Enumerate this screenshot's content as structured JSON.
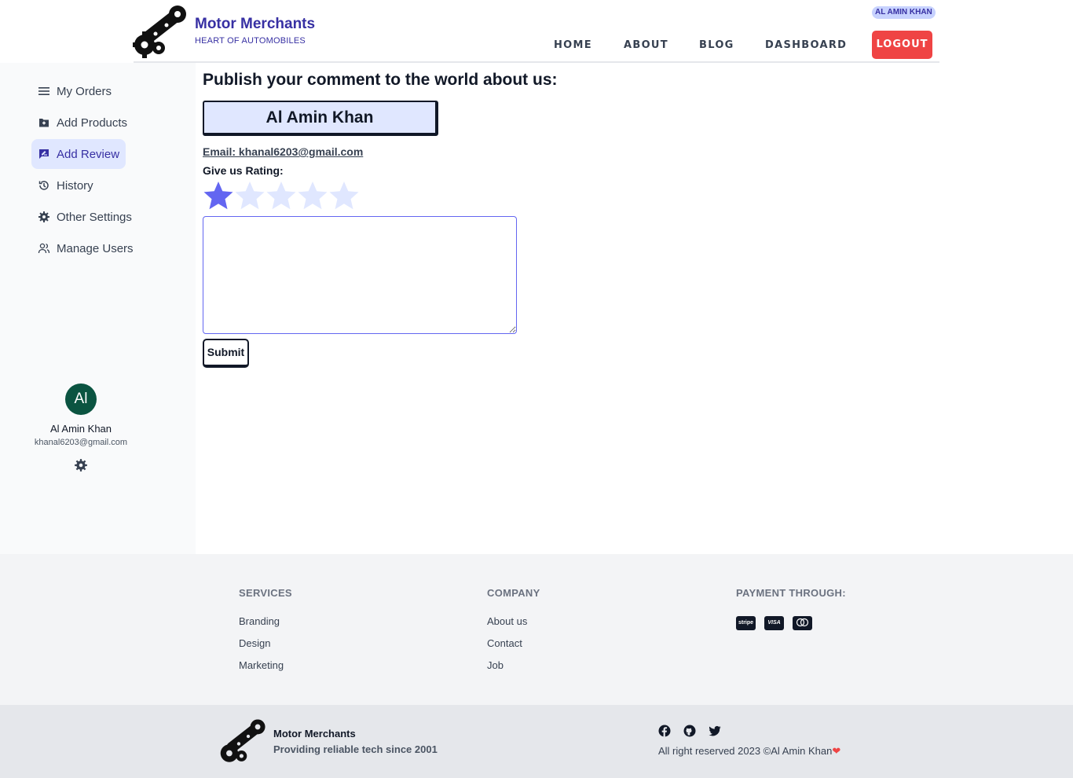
{
  "header": {
    "brand_title": "Motor Merchants",
    "brand_subtitle": "HEART OF AUTOMOBILES",
    "user_chip": "AL AMIN KHAN",
    "nav": [
      "HOME",
      "ABOUT",
      "BLOG",
      "DASHBOARD"
    ],
    "logout_label": "LOGOUT",
    "logout_color": "#ef4444"
  },
  "sidebar": {
    "items": [
      {
        "label": "My Orders",
        "icon": "list-icon"
      },
      {
        "label": "Add Products",
        "icon": "folder-plus-icon"
      },
      {
        "label": "Add Review",
        "icon": "review-icon",
        "active": true
      },
      {
        "label": "History",
        "icon": "history-icon"
      },
      {
        "label": "Other Settings",
        "icon": "gear-icon"
      },
      {
        "label": "Manage Users",
        "icon": "users-icon"
      }
    ],
    "avatar_initials": "Al",
    "user_name": "Al Amin Khan",
    "user_email": "khanal6203@gmail.com"
  },
  "review": {
    "title": "Publish your comment to the world about us:",
    "name": "Al Amin Khan",
    "email": "Email: khanal6203@gmail.com",
    "rating_label": "Give us Rating:",
    "rating": 1,
    "rating_max": 5,
    "comment_value": "",
    "submit_label": "Submit",
    "accent": "#6366f1"
  },
  "footer": {
    "services_heading": "SERVICES",
    "services": [
      "Branding",
      "Design",
      "Marketing"
    ],
    "company_heading": "COMPANY",
    "company": [
      "About us",
      "Contact",
      "Job"
    ],
    "payment_heading": "PAYMENT THROUGH:",
    "payments": [
      "stripe",
      "VISA",
      "mastercard"
    ]
  },
  "bottom": {
    "brand": "Motor Merchants",
    "tagline": "Providing reliable tech since 2001",
    "social": [
      "facebook-icon",
      "github-icon",
      "twitter-icon"
    ],
    "copyright": "All right reserved 2023 ©Al Amin Khan",
    "heart": "❤"
  }
}
